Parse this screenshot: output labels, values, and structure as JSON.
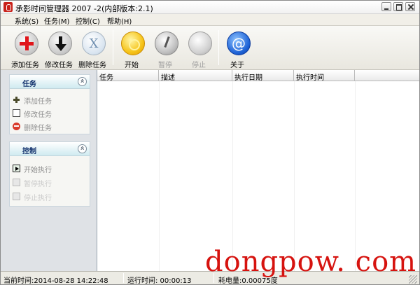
{
  "window": {
    "title": "承影时间管理器 2007 -2(内部版本:2.1)"
  },
  "menu": {
    "items": [
      "系统(S)",
      "任务(M)",
      "控制(C)",
      "帮助(H)"
    ]
  },
  "toolbar": {
    "add_label": "添加任务",
    "edit_label": "修改任务",
    "delete_label": "删除任务",
    "start_label": "开始",
    "pause_label": "暂停",
    "stop_label": "停止",
    "about_label": "关于"
  },
  "sidebar": {
    "tasks_group": {
      "title": "任务",
      "items": [
        "添加任务",
        "修改任务",
        "删除任务"
      ]
    },
    "control_group": {
      "title": "控制",
      "items": [
        "开始执行",
        "暂停执行",
        "停止执行"
      ]
    }
  },
  "table": {
    "columns": [
      "任务",
      "描述",
      "执行日期",
      "执行时间"
    ],
    "rows": []
  },
  "status": {
    "current_time": "当前时间:2014-08-28 14:22:48",
    "run_time": "运行时间: 00:00:13",
    "power": "耗电量:0.00075度"
  },
  "watermark": {
    "text": "dongpow. com"
  },
  "icons": {
    "add": "plus-circle-icon",
    "edit": "down-arrow-icon",
    "delete": "x-circle-icon",
    "start": "start-disc-icon",
    "pause": "pause-disc-icon",
    "stop": "stop-disc-icon",
    "about": "at-sign-icon"
  }
}
